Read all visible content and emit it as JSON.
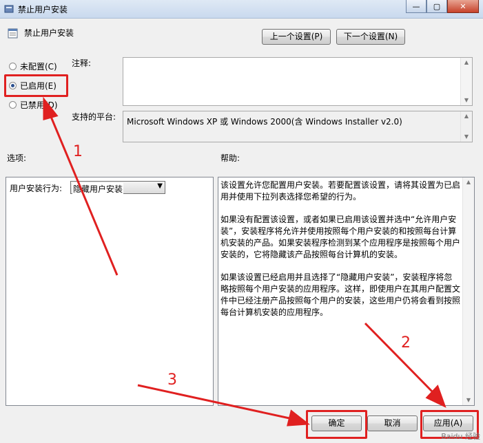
{
  "window": {
    "title": "禁止用户安装"
  },
  "dialog": {
    "title": "禁止用户安装",
    "prev_setting": "上一个设置(P)",
    "next_setting": "下一个设置(N)"
  },
  "radios": {
    "not_configured": "未配置(C)",
    "enabled": "已启用(E)",
    "disabled": "已禁用(D)",
    "selected": "enabled"
  },
  "comment": {
    "label": "注释:",
    "value": ""
  },
  "platform": {
    "label": "支持的平台:",
    "value": "Microsoft Windows XP 或 Windows 2000(含 Windows Installer v2.0)"
  },
  "options": {
    "header": "选项:",
    "behavior_label": "用户安装行为:",
    "behavior_value": "隐藏用户安装"
  },
  "help": {
    "header": "帮助:",
    "paragraphs": [
      "该设置允许您配置用户安装。若要配置该设置，请将其设置为已启用并使用下拉列表选择您希望的行为。",
      "如果没有配置该设置，或者如果已启用该设置并选中“允许用户安装”，安装程序将允许并使用按照每个用户安装的和按照每台计算机安装的产品。如果安装程序检测到某个应用程序是按照每个用户安装的，它将隐藏该产品按照每台计算机的安装。",
      "如果该设置已经启用并且选择了“隐藏用户安装”，安装程序将忽略按照每个用户安装的应用程序。这样，即使用户在其用户配置文件中已经注册产品按照每个用户的安装，这些用户仍将会看到按照每台计算机安装的应用程序。"
    ]
  },
  "buttons": {
    "ok": "确定",
    "cancel": "取消",
    "apply": "应用(A)"
  },
  "annotations": {
    "n1": "1",
    "n2": "2",
    "n3": "3",
    "color": "#e02020"
  },
  "watermark": "Baidu 经验"
}
